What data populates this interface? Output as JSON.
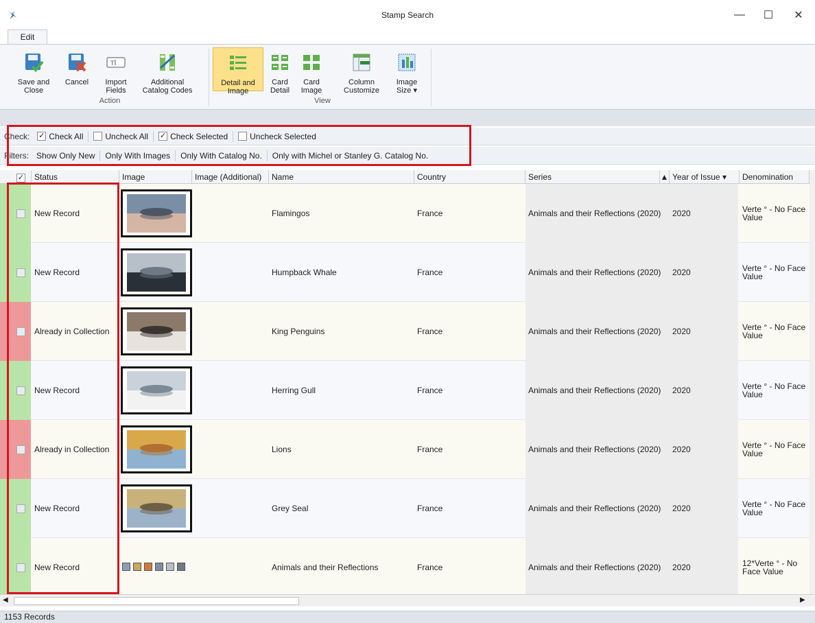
{
  "window": {
    "title": "Stamp Search"
  },
  "tabs": [
    {
      "label": "Edit"
    }
  ],
  "ribbon": {
    "action": {
      "label": "Action",
      "buttons": [
        {
          "label1": "Save and",
          "label2": "Close",
          "icon": "save-close-icon"
        },
        {
          "label1": "Cancel",
          "label2": "",
          "icon": "cancel-icon"
        },
        {
          "label1": "Import",
          "label2": "Fields",
          "icon": "import-fields-icon"
        },
        {
          "label1": "Additional",
          "label2": "Catalog Codes",
          "icon": "catalog-codes-icon"
        }
      ]
    },
    "view": {
      "label": "View",
      "buttons": [
        {
          "label1": "Detail and",
          "label2": "Image",
          "icon": "detail-image-icon",
          "active": true
        },
        {
          "label1": "Card",
          "label2": "Detail",
          "icon": "card-detail-icon"
        },
        {
          "label1": "Card",
          "label2": "Image",
          "icon": "card-image-icon"
        },
        {
          "label1": "Column",
          "label2": "Customize",
          "icon": "column-customize-icon"
        },
        {
          "label1": "Image",
          "label2": "Size ▾",
          "icon": "image-size-icon"
        }
      ]
    }
  },
  "check_bar": {
    "label": "Check:",
    "items": [
      {
        "label": "Check All",
        "checked": true
      },
      {
        "label": "Uncheck All",
        "checked": false
      },
      {
        "label": "Check Selected",
        "checked": true
      },
      {
        "label": "Uncheck Selected",
        "checked": false
      }
    ]
  },
  "filter_bar": {
    "label": "Filters:",
    "items": [
      "Show Only New",
      "Only With Images",
      "Only With Catalog No.",
      "Only with Michel or Stanley G. Catalog No."
    ]
  },
  "columns": {
    "check": "✓",
    "status": "Status",
    "image": "Image",
    "image_additional": "Image (Additional)",
    "name": "Name",
    "country": "Country",
    "series": "Series",
    "year": "Year of Issue",
    "denomination": "Denomination"
  },
  "rows": [
    {
      "status": "New Record",
      "name": "Flamingos",
      "country": "France",
      "series": "Animals and their Reflections (2020)",
      "year": "2020",
      "denomination": "Verte ° - No Face Value",
      "kind": "new"
    },
    {
      "status": "New Record",
      "name": "Humpback Whale",
      "country": "France",
      "series": "Animals and their Reflections (2020)",
      "year": "2020",
      "denomination": "Verte ° - No Face Value",
      "kind": "new"
    },
    {
      "status": "Already in Collection",
      "name": "King Penguins",
      "country": "France",
      "series": "Animals and their Reflections (2020)",
      "year": "2020",
      "denomination": "Verte ° - No Face Value",
      "kind": "owned"
    },
    {
      "status": "New Record",
      "name": "Herring Gull",
      "country": "France",
      "series": "Animals and their Reflections (2020)",
      "year": "2020",
      "denomination": "Verte ° - No Face Value",
      "kind": "new"
    },
    {
      "status": "Already in Collection",
      "name": "Lions",
      "country": "France",
      "series": "Animals and their Reflections (2020)",
      "year": "2020",
      "denomination": "Verte ° - No Face Value",
      "kind": "owned"
    },
    {
      "status": "New Record",
      "name": "Grey Seal",
      "country": "France",
      "series": "Animals and their Reflections (2020)",
      "year": "2020",
      "denomination": "Verte ° - No Face Value",
      "kind": "new"
    },
    {
      "status": "New Record",
      "name": "Animals and their Reflections",
      "country": "France",
      "series": "Animals and their Reflections (2020)",
      "year": "2020",
      "denomination": "12*Verte ° - No Face Value",
      "kind": "new"
    }
  ],
  "status_bar": {
    "records": "1153 Records"
  },
  "colors": {
    "new": "#b9e4a8",
    "owned": "#ee9999",
    "highlight": "#d0181e",
    "active_button": "#fce08a"
  }
}
